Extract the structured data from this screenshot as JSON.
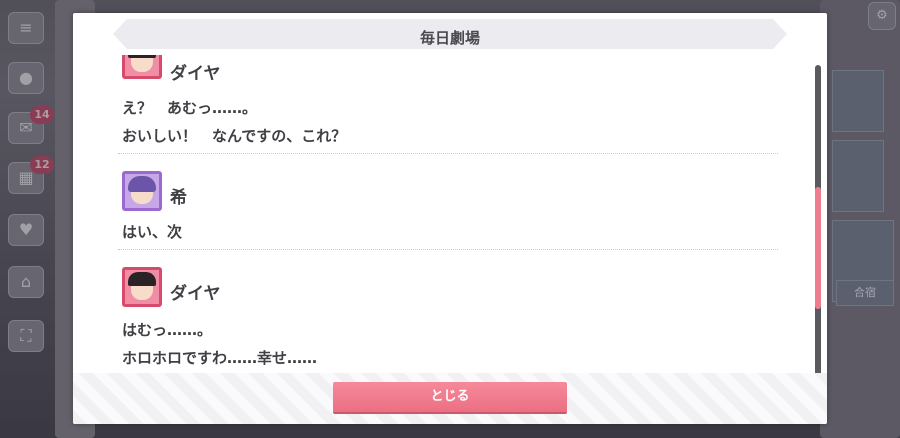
{
  "dialog": {
    "title": "毎日劇場",
    "close_label": "とじる"
  },
  "entries": [
    {
      "speaker": "ダイヤ",
      "character": "dia",
      "lines": [
        "え？　あむっ……。",
        "おいしい！　なんですの、これ？"
      ]
    },
    {
      "speaker": "希",
      "character": "nozomi",
      "lines": [
        "はい、次"
      ]
    },
    {
      "speaker": "ダイヤ",
      "character": "dia",
      "lines": [
        "はむっ……。",
        "ホロホロですわ……幸せ……"
      ]
    }
  ],
  "background": {
    "badges": [
      "14",
      "12"
    ],
    "tile_label": "合宿"
  },
  "colors": {
    "accent": "#ef7d8e",
    "button": "#ec6f83",
    "dia_frame": "#d84a6c",
    "nozomi_frame": "#9a6ad0"
  }
}
